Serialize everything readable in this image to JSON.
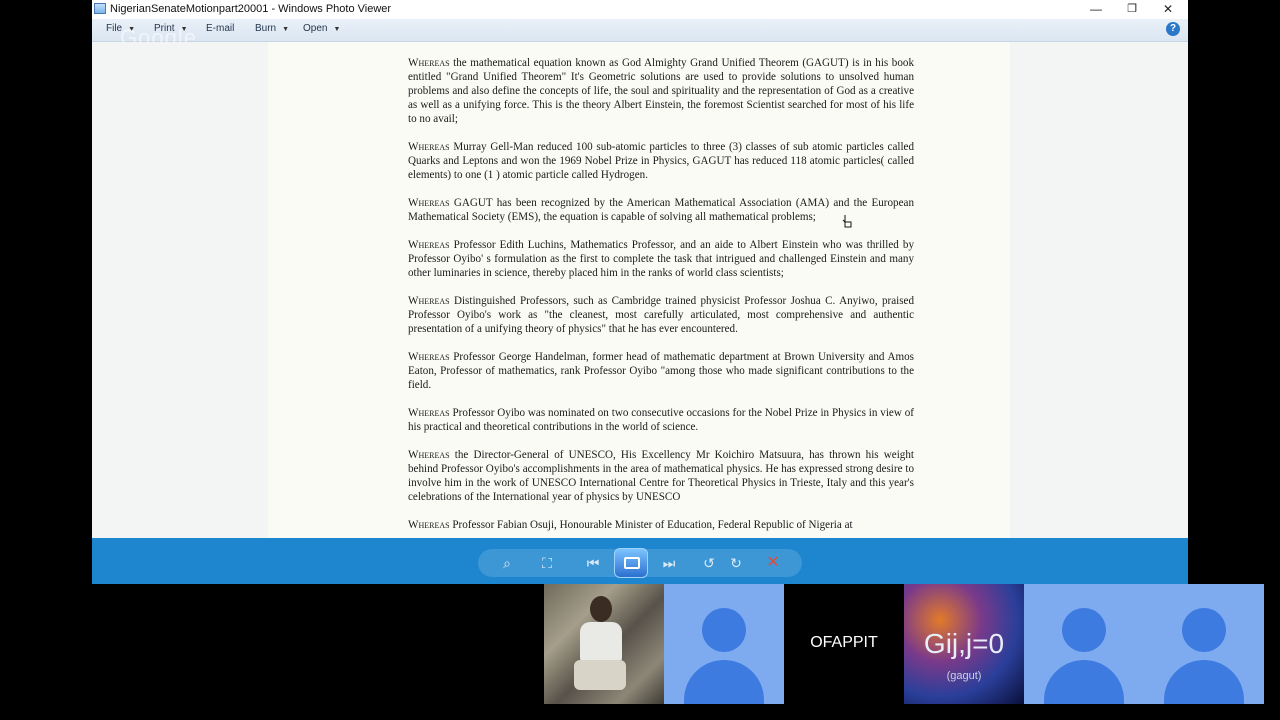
{
  "window": {
    "title": "NigerianSenateMotionpart20001 - Windows Photo Viewer",
    "minimize": "—",
    "maximize": "❐",
    "close": "✕"
  },
  "menu": {
    "file": "File",
    "print": "Print",
    "email": "E-mail",
    "burn": "Burn",
    "open": "Open",
    "caret": "▼",
    "help": "?"
  },
  "watermark": "Google",
  "document": {
    "paragraphs": [
      {
        "lead": "Whereas",
        "text": " the mathematical equation known as God Almighty Grand Unified Theorem (GAGUT) is in his book entitled \"Grand Unified Theorem\" It's Geometric solutions are used to provide solutions to unsolved human problems and also define the concepts of life, the soul and spirituality and the representation of God as a creative as well as a unifying force. This is the theory Albert Einstein, the foremost Scientist searched for most of his life to no avail;"
      },
      {
        "lead": "Whereas",
        "text": " Murray Gell-Man reduced 100 sub-atomic particles to three (3) classes of sub atomic particles called Quarks and Leptons and won the 1969 Nobel Prize in Physics, GAGUT has reduced 118 atomic particles( called elements) to one (1 ) atomic particle called Hydrogen."
      },
      {
        "lead": "Whereas",
        "text": " GAGUT has been recognized by the American Mathematical Association (AMA) and the European Mathematical Society (EMS), the equation is capable of solving all mathematical problems;"
      },
      {
        "lead": "Whereas",
        "text": " Professor Edith Luchins, Mathematics Professor, and an aide to Albert Einstein who was thrilled by Professor Oyibo' s formulation as the first to complete the task that intrigued and challenged Einstein and many other luminaries in science, thereby placed him in the ranks of world class scientists;"
      },
      {
        "lead": "Whereas",
        "text": " Distinguished Professors, such as Cambridge trained physicist Professor Joshua C. Anyiwo, praised Professor Oyibo's work as \"the cleanest, most carefully articulated, most comprehensive and authentic presentation of a unifying theory of physics\" that he has ever encountered."
      },
      {
        "lead": "Whereas",
        "text": " Professor George Handelman, former head of mathematic department at Brown University and Amos Eaton, Professor of mathematics, rank Professor Oyibo \"among those who made significant contributions to the field."
      },
      {
        "lead": "Whereas",
        "text": " Professor Oyibo was nominated on two consecutive occasions for the Nobel Prize in Physics in view of his practical and theoretical contributions in the world of science."
      },
      {
        "lead": "Whereas",
        "text": " the Director-General of UNESCO, His Excellency Mr Koichiro Matsuura, has thrown his weight behind Professor Oyibo's accomplishments in the area of mathematical physics. He has expressed strong desire to involve him in the work of UNESCO International Centre for Theoretical Physics in Trieste, Italy and this year's celebrations of the International year of physics by UNESCO"
      },
      {
        "lead": "Whereas",
        "text": " Professor Fabian Osuji, Honourable Minister of Education, Federal Republic of Nigeria at"
      }
    ]
  },
  "controls": {
    "zoom": "⌕",
    "actual_size": "⛶",
    "previous": "⏮",
    "next": "⏭",
    "rotate_ccw": "↺",
    "rotate_cw": "↻",
    "delete": "✕"
  },
  "participants": {
    "name_tile": "OFAPPIT",
    "galaxy_equation": "Gij,j=0",
    "galaxy_caption": "(gagut)"
  }
}
